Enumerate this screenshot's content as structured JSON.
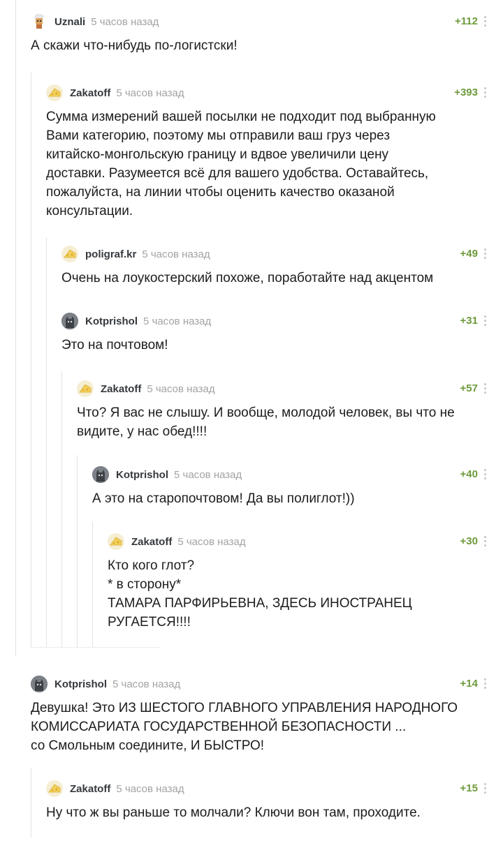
{
  "comments": [
    {
      "author": "Uznali",
      "time": "5 часов назад",
      "rating": "+112",
      "avatar": "chef-avatar-icon",
      "text": "А скажи что-нибудь по-логистски!"
    },
    {
      "author": "Zakatoff",
      "time": "5 часов назад",
      "rating": "+393",
      "avatar": "cheese-avatar-icon",
      "text": "Сумма измерений вашей посылки не подходит под выбранную\nВами категорию, поэтому мы отправили ваш груз через\nкитайско-монгольскую границу и вдвое увеличили цену\nдоставки. Разумеется всё для вашего удобства. Оставайтесь,\nпожалуйста, на линии чтобы оценить качество оказаной\nконсультации."
    },
    {
      "author": "poligraf.kr",
      "time": "5 часов назад",
      "rating": "+49",
      "avatar": "cheese-avatar-icon",
      "text": "Очень на лоукостерский похоже, поработайте над акцентом"
    },
    {
      "author": "Kotprishol",
      "time": "5 часов назад",
      "rating": "+31",
      "avatar": "cat-avatar-icon",
      "text": "Это на почтовом!"
    },
    {
      "author": "Zakatoff",
      "time": "5 часов назад",
      "rating": "+57",
      "avatar": "cheese-avatar-icon",
      "text": "Что? Я вас не слышу. И вообще, молодой человек, вы что не\nвидите, у нас обед!!!!"
    },
    {
      "author": "Kotprishol",
      "time": "5 часов назад",
      "rating": "+40",
      "avatar": "cat-avatar-icon",
      "text": "А это на старопочтовом! Да вы полиглот!))"
    },
    {
      "author": "Zakatoff",
      "time": "5 часов назад",
      "rating": "+30",
      "avatar": "cheese-avatar-icon",
      "text": "Кто кого глот?\n* в сторону*\nТАМАРА ПАРФИРЬЕВНА, ЗДЕСЬ ИНОСТРАНЕЦ\nРУГАЕТСЯ!!!!"
    },
    {
      "author": "Kotprishol",
      "time": "5 часов назад",
      "rating": "+14",
      "avatar": "cat-avatar-icon",
      "text": "Девушка! Это ИЗ ШЕСТОГО ГЛАВНОГО УПРАВЛЕНИЯ НАРОДНОГО\nКОМИССАРИАТА ГОСУДАРСТВЕННОЙ БЕЗОПАСНОСТИ ...\nсо Смольным соедините, И БЫСТРО!"
    },
    {
      "author": "Zakatoff",
      "time": "5 часов назад",
      "rating": "+15",
      "avatar": "cheese-avatar-icon",
      "text": "Ну что ж вы раньше то молчали? Ключи вон там, проходите."
    }
  ]
}
